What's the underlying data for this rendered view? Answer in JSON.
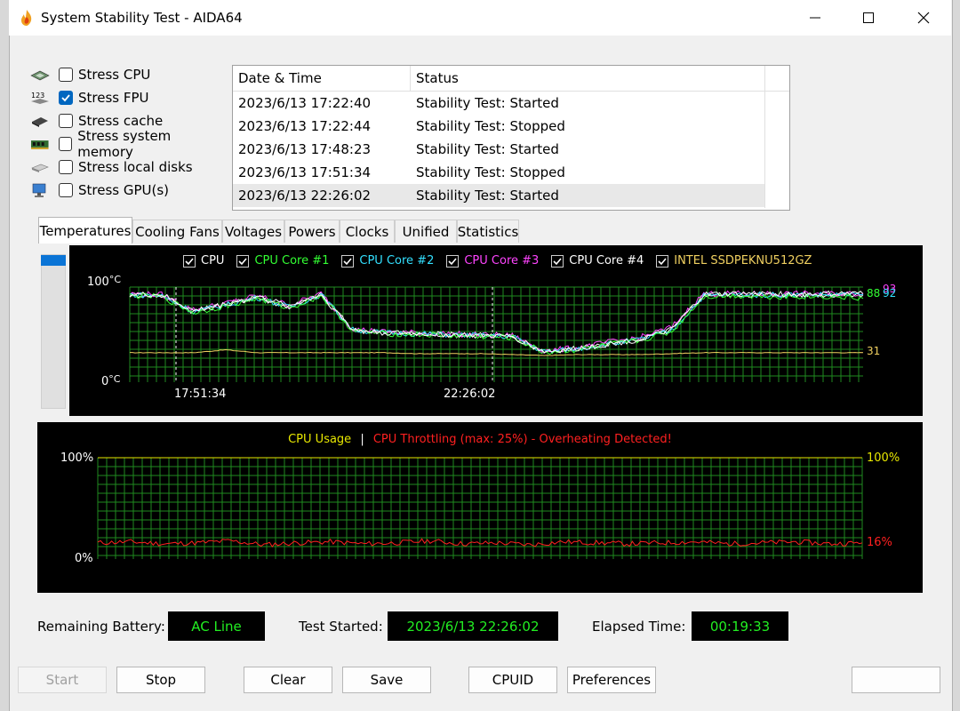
{
  "window": {
    "title": "System Stability Test - AIDA64"
  },
  "stress": [
    {
      "label": "Stress CPU",
      "checked": false,
      "icon": "cpu-chip-icon"
    },
    {
      "label": "Stress FPU",
      "checked": true,
      "icon": "fpu-123-icon"
    },
    {
      "label": "Stress cache",
      "checked": false,
      "icon": "cache-chip-icon"
    },
    {
      "label": "Stress system memory",
      "checked": false,
      "icon": "memory-module-icon"
    },
    {
      "label": "Stress local disks",
      "checked": false,
      "icon": "disk-drive-icon"
    },
    {
      "label": "Stress GPU(s)",
      "checked": false,
      "icon": "gpu-monitor-icon"
    }
  ],
  "log": {
    "headers": [
      "Date & Time",
      "Status"
    ],
    "rows": [
      [
        "2023/6/13 17:22:40",
        "Stability Test: Started"
      ],
      [
        "2023/6/13 17:22:44",
        "Stability Test: Stopped"
      ],
      [
        "2023/6/13 17:48:23",
        "Stability Test: Started"
      ],
      [
        "2023/6/13 17:51:34",
        "Stability Test: Stopped"
      ],
      [
        "2023/6/13 22:26:02",
        "Stability Test: Started"
      ]
    ]
  },
  "tabs": [
    "Temperatures",
    "Cooling Fans",
    "Voltages",
    "Powers",
    "Clocks",
    "Unified",
    "Statistics"
  ],
  "temp_chart": {
    "y_top_label": "100",
    "y_bottom_label": "0",
    "unit": "°C",
    "legend": [
      {
        "label": "CPU",
        "color": "#ffffff"
      },
      {
        "label": "CPU Core #1",
        "color": "#33ff33"
      },
      {
        "label": "CPU Core #2",
        "color": "#33e0ff"
      },
      {
        "label": "CPU Core #3",
        "color": "#ff44ff"
      },
      {
        "label": "CPU Core #4",
        "color": "#ffffff"
      },
      {
        "label": "INTEL SSDPEKNU512GZ",
        "color": "#f0d060"
      }
    ],
    "x_labels": [
      "17:51:34",
      "22:26:02"
    ],
    "value_labels": [
      {
        "text": "88",
        "color": "#33ff33"
      },
      {
        "text": "93",
        "color": "#ff44ff"
      },
      {
        "text": "92",
        "color": "#33e0ff"
      },
      {
        "text": "31",
        "color": "#f0d060"
      }
    ]
  },
  "usage_chart": {
    "legend_usage": "CPU Usage",
    "separator": "|",
    "legend_throttle": "CPU Throttling (max: 25%) - Overheating Detected!",
    "y_top_left": "100%",
    "y_bottom_left": "0%",
    "y_top_right": "100%",
    "current_throttle": "16%",
    "colors": {
      "usage": "#e8e800",
      "throttle": "#ff2020"
    }
  },
  "chart_data": [
    {
      "type": "line",
      "title": "",
      "ylim": [
        0,
        100
      ],
      "unit": "°C",
      "x_markers": [
        "17:51:34",
        "22:26:02"
      ],
      "series": [
        {
          "name": "CPU",
          "values": [
            92,
            92,
            75,
            82,
            90,
            80,
            92,
            55,
            52,
            51,
            50,
            49,
            48,
            32,
            35,
            40,
            45,
            55,
            92,
            93,
            93,
            92,
            93,
            93
          ]
        },
        {
          "name": "CPU Core #1",
          "values": [
            91,
            90,
            73,
            80,
            88,
            78,
            91,
            54,
            51,
            50,
            49,
            48,
            47,
            31,
            34,
            39,
            44,
            53,
            90,
            91,
            90,
            90,
            90,
            88
          ]
        },
        {
          "name": "CPU Core #2",
          "values": [
            92,
            91,
            74,
            81,
            89,
            79,
            92,
            55,
            52,
            51,
            50,
            49,
            48,
            32,
            35,
            40,
            45,
            54,
            91,
            92,
            92,
            92,
            92,
            92
          ]
        },
        {
          "name": "CPU Core #3",
          "values": [
            93,
            92,
            76,
            83,
            91,
            81,
            93,
            56,
            53,
            52,
            51,
            50,
            49,
            33,
            36,
            42,
            47,
            58,
            93,
            93,
            93,
            93,
            93,
            93
          ]
        },
        {
          "name": "CPU Core #4",
          "values": [
            92,
            91,
            74,
            82,
            89,
            79,
            92,
            55,
            52,
            51,
            50,
            49,
            48,
            32,
            35,
            40,
            45,
            55,
            92,
            92,
            92,
            92,
            92,
            92
          ]
        },
        {
          "name": "INTEL SSDPEKNU512GZ",
          "values": [
            31,
            31,
            31,
            34,
            31,
            31,
            31,
            31,
            31,
            30,
            30,
            30,
            29,
            28,
            29,
            29,
            29,
            30,
            31,
            31,
            31,
            31,
            31,
            31
          ]
        }
      ]
    },
    {
      "type": "line",
      "title": "",
      "ylim": [
        0,
        100
      ],
      "unit": "%",
      "series": [
        {
          "name": "CPU Usage",
          "values": [
            100,
            100,
            100,
            100,
            100,
            100,
            100,
            100,
            100,
            100,
            100,
            100,
            100,
            100,
            100,
            100,
            100,
            100,
            100,
            100,
            100,
            100,
            100,
            100
          ]
        },
        {
          "name": "CPU Throttling",
          "values": [
            16,
            17,
            15,
            16,
            18,
            14,
            16,
            17,
            15,
            16,
            18,
            15,
            16,
            14,
            17,
            16,
            15,
            16,
            17,
            15,
            16,
            17,
            15,
            16
          ]
        }
      ]
    }
  ],
  "info": {
    "battery_label": "Remaining Battery:",
    "battery_value": "AC Line",
    "started_label": "Test Started:",
    "started_value": "2023/6/13 22:26:02",
    "elapsed_label": "Elapsed Time:",
    "elapsed_value": "00:19:33"
  },
  "buttons": {
    "start": "Start",
    "stop": "Stop",
    "clear": "Clear",
    "save": "Save",
    "cpuid": "CPUID",
    "preferences": "Preferences"
  }
}
